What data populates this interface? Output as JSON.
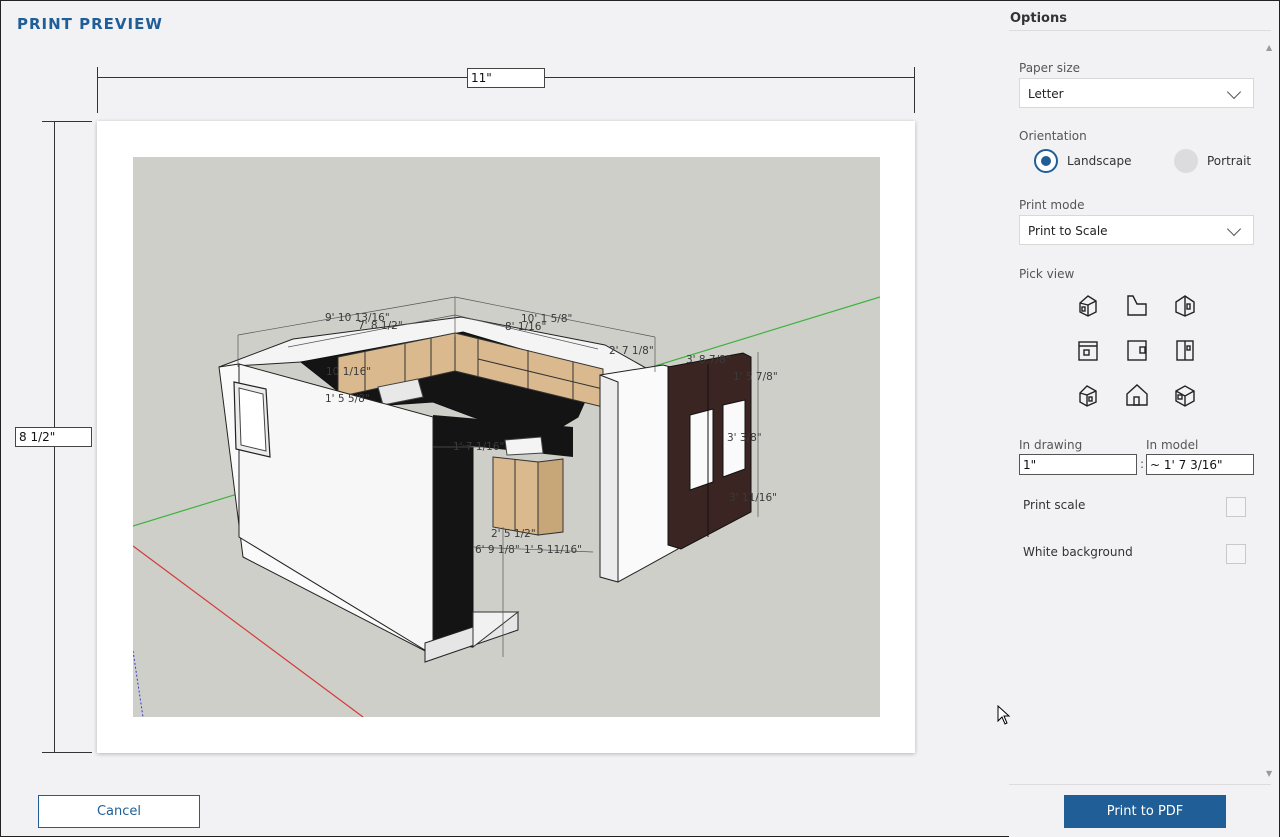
{
  "window": {
    "title": "PRINT PREVIEW"
  },
  "preview": {
    "width_value": "11\"",
    "height_value": "8 1/2\"",
    "dimension_labels": [
      "9' 10 13/16\"",
      "10' 1 5/8\"",
      "7' 8 1/2\"",
      "8' 1/16\"",
      "2' 7 1/8\"",
      "3' 8 7/8\"",
      "10 1/16\"",
      "1' 5 7/8\"",
      "1' 5 5/8\"",
      "1' 7 1/16\"",
      "3' 3/8\"",
      "3' 11/16\"",
      "2' 5 1/2\"",
      "6' 9 1/8\"",
      "1' 5 11/16\""
    ]
  },
  "options": {
    "title": "Options",
    "paper_size_label": "Paper size",
    "paper_size_value": "Letter",
    "orientation_label": "Orientation",
    "landscape_label": "Landscape",
    "portrait_label": "Portrait",
    "orientation_selected": "Landscape",
    "print_mode_label": "Print mode",
    "print_mode_value": "Print to Scale",
    "pick_view_label": "Pick view",
    "views": [
      "iso-view-icon",
      "top-view-icon",
      "front-view-icon",
      "bottom-view-icon",
      "left-view-icon",
      "right-view-icon",
      "back-view-icon",
      "house-view-icon",
      "perspective-view-icon"
    ],
    "in_drawing_label": "In drawing",
    "in_drawing_value": "1\"",
    "in_model_label": "In model",
    "in_model_value": "~ 1' 7 3/16\"",
    "print_scale_label": "Print scale",
    "print_scale_checked": false,
    "white_background_label": "White background",
    "white_background_checked": false
  },
  "buttons": {
    "cancel_label": "Cancel",
    "print_label": "Print to PDF"
  },
  "colors": {
    "accent": "#1f5e96",
    "scene_bg": "#cfcfca",
    "cabinet": "#d9b98d",
    "countertop": "#141414",
    "door": "#3a2522"
  }
}
